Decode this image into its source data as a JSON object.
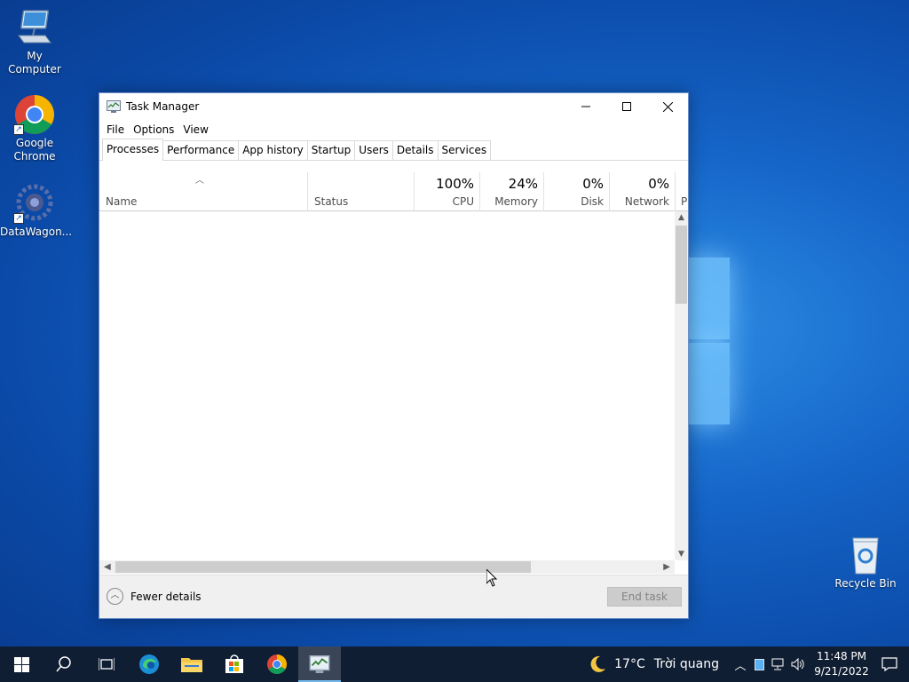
{
  "desktop": {
    "icons": [
      {
        "label": "My Computer"
      },
      {
        "label": "Google Chrome"
      },
      {
        "label": "DataWagon..."
      },
      {
        "label": "Recycle Bin"
      }
    ]
  },
  "window": {
    "title": "Task Manager",
    "menu": [
      "File",
      "Options",
      "View"
    ],
    "tabs": [
      "Processes",
      "Performance",
      "App history",
      "Startup",
      "Users",
      "Details",
      "Services"
    ],
    "active_tab": "Processes",
    "columns": {
      "name": "Name",
      "status": "Status",
      "cpu": {
        "pct": "100%",
        "label": "CPU"
      },
      "memory": {
        "pct": "24%",
        "label": "Memory"
      },
      "disk": {
        "pct": "0%",
        "label": "Disk"
      },
      "network": {
        "pct": "0%",
        "label": "Network"
      },
      "next": "P"
    },
    "footer": {
      "fewer_details": "Fewer details",
      "end_task": "End task"
    }
  },
  "taskbar": {
    "weather": {
      "temp": "17°C",
      "desc": "Trời quang"
    },
    "time": "11:48 PM",
    "date": "9/21/2022"
  },
  "colors": {
    "taskbar_bg": "#101e33",
    "accent": "#76b9ed",
    "window_border": "#6b8fc9"
  }
}
